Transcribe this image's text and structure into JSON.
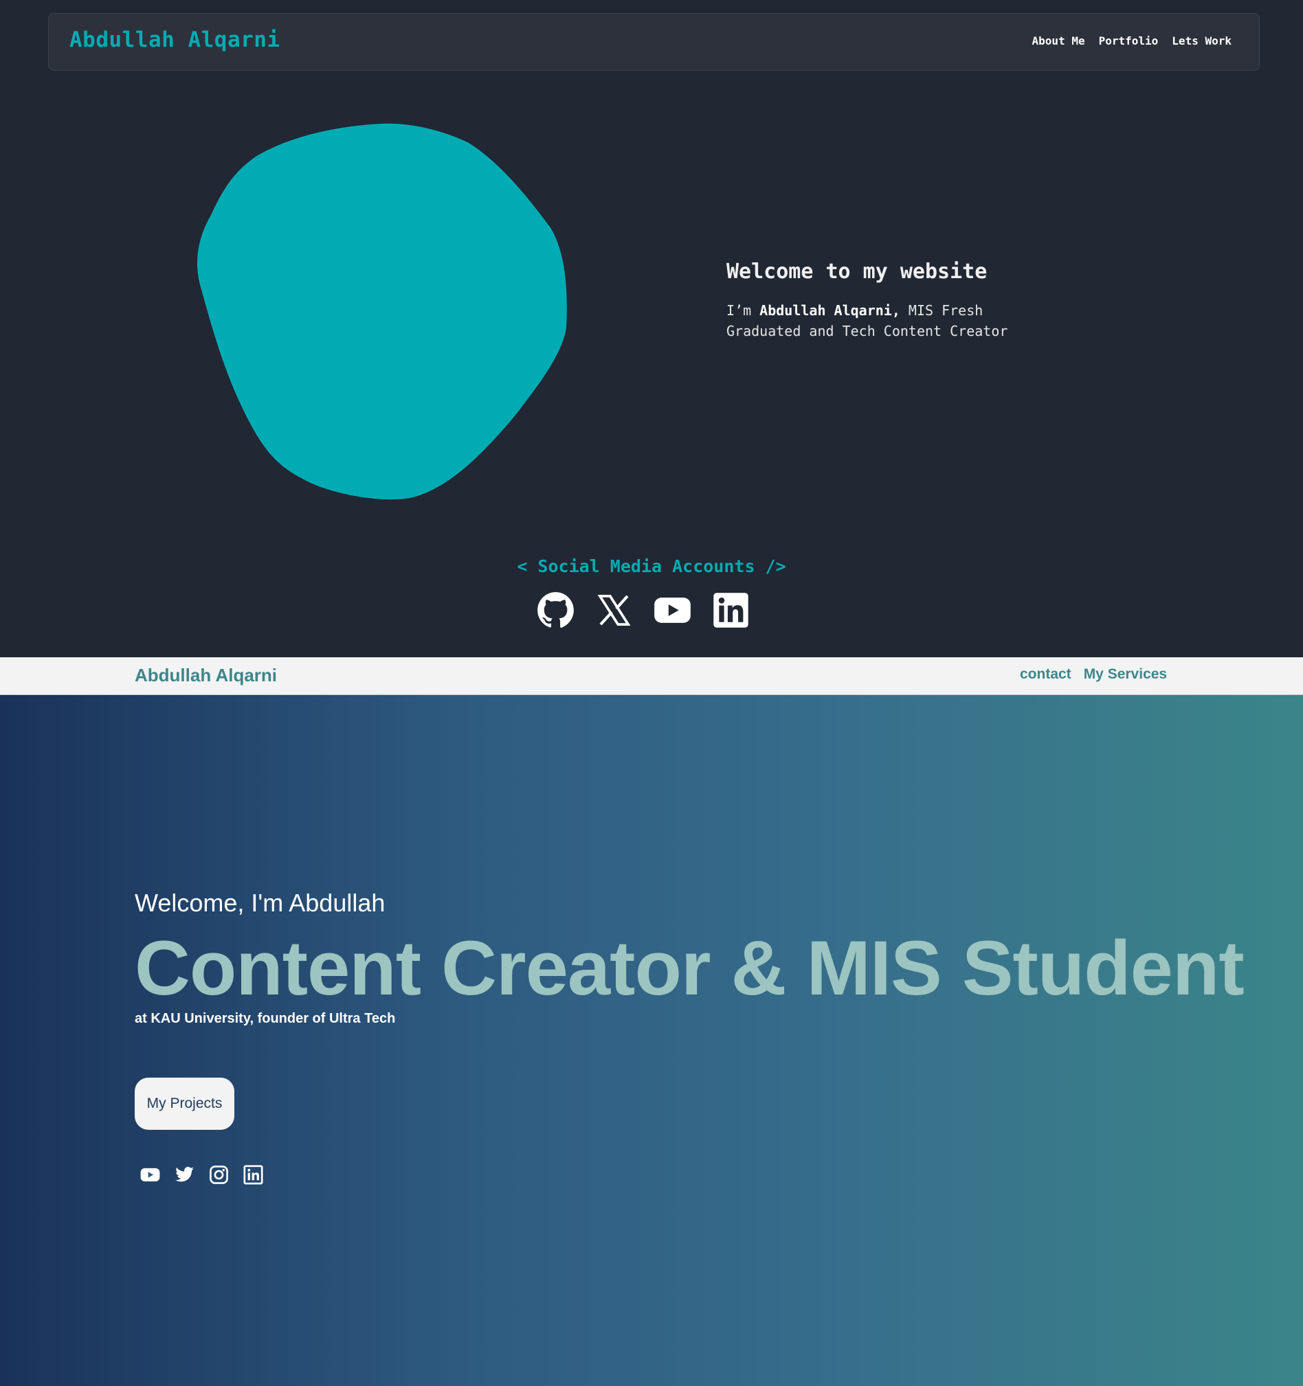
{
  "section1": {
    "brand": "Abdullah Alqarni",
    "nav": [
      "About Me",
      "Portfolio",
      "Lets Work"
    ],
    "hero": {
      "title": "Welcome to my website",
      "intro_prefix": "I’m ",
      "name": "Abdullah Alqarni,",
      "intro_suffix": " MIS Fresh Graduated and Tech Content Creator"
    },
    "social": {
      "title": "< Social Media Accounts />",
      "icons": [
        "github-icon",
        "x-icon",
        "youtube-icon",
        "linkedin-icon"
      ]
    },
    "colors": {
      "background": "#212733",
      "accent": "#08aab3",
      "nav_bg": "#2c313b"
    }
  },
  "section2": {
    "brand": "Abdullah Alqarni",
    "nav": [
      "contact",
      "My Services"
    ],
    "hero": {
      "greeting": "Welcome, I'm Abdullah",
      "headline": "Content Creator & MIS Student",
      "subtitle": "at KAU University, founder of Ultra Tech",
      "button": "My Projects"
    },
    "social": {
      "icons": [
        "youtube-icon",
        "twitter-icon",
        "instagram-icon",
        "linkedin-icon"
      ]
    },
    "colors": {
      "nav_bg": "#f3f3f3",
      "brand": "#3d868a",
      "headline": "#9cc4c1",
      "gradient_start": "#1a3259",
      "gradient_end": "#3b8589"
    }
  }
}
